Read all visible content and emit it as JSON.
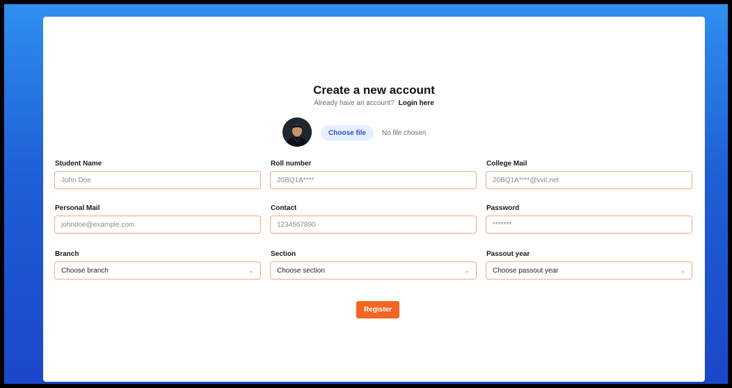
{
  "header": {
    "title": "Create a new account",
    "subtitle_text": "Already have an account?",
    "login_link": "Login here"
  },
  "file_upload": {
    "button_label": "Choose file",
    "status": "No file chosen"
  },
  "fields": {
    "student_name": {
      "label": "Student Name",
      "placeholder": "John Doe"
    },
    "roll_number": {
      "label": "Roll number",
      "placeholder": "20BQ1A****"
    },
    "college_mail": {
      "label": "College Mail",
      "placeholder": "20BQ1A****@vvit.net"
    },
    "personal_mail": {
      "label": "Personal Mail",
      "placeholder": "johndoe@example.com"
    },
    "contact": {
      "label": "Contact",
      "placeholder": "1234567890"
    },
    "password": {
      "label": "Password",
      "placeholder": "*******"
    },
    "branch": {
      "label": "Branch",
      "selected": "Choose branch"
    },
    "section": {
      "label": "Section",
      "selected": "Choose section"
    },
    "passout_year": {
      "label": "Passout year",
      "selected": "Choose passout year"
    }
  },
  "actions": {
    "register_label": "Register"
  },
  "colors": {
    "accent": "#f26522",
    "input_border": "#f2a68a",
    "file_button_bg": "#e6efff",
    "background_top": "#2f8ff0",
    "background_bottom": "#1b47c9"
  },
  "icons": {
    "select_arrow": "chevron-down-icon"
  }
}
